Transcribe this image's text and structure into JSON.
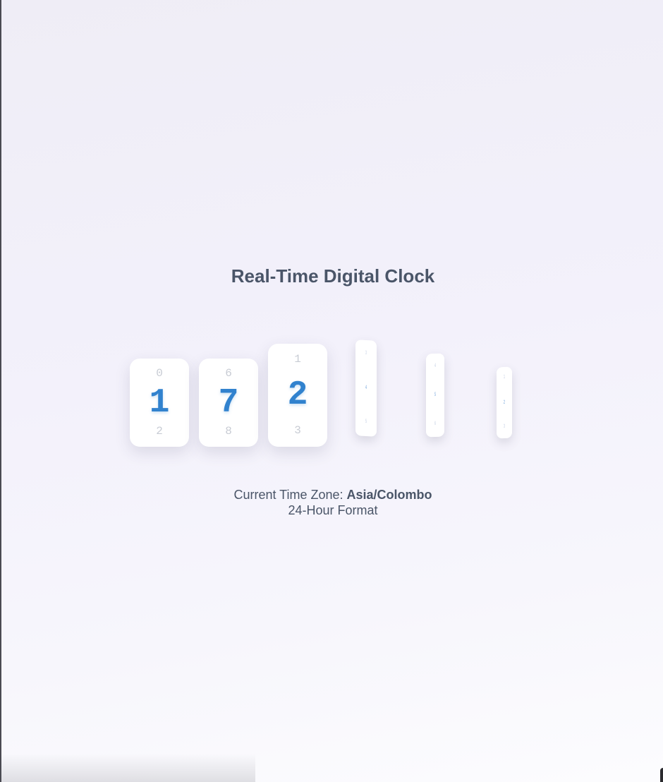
{
  "title": "Real-Time Digital Clock",
  "clock": {
    "digits": [
      {
        "prev": "0",
        "current": "1",
        "next": "2"
      },
      {
        "prev": "6",
        "current": "7",
        "next": "8"
      },
      {
        "prev": "1",
        "current": "2",
        "next": "3"
      },
      {
        "prev": "3",
        "current": "4",
        "next": "5"
      },
      {
        "prev": "4",
        "current": "5",
        "next": "6"
      },
      {
        "prev": "1",
        "current": "2",
        "next": "3"
      }
    ]
  },
  "info": {
    "timezone_label": "Current Time Zone: ",
    "timezone_value": "Asia/Colombo",
    "format_label": "24-Hour Format"
  },
  "colors": {
    "accent": "#3182ce",
    "text": "#4a5568",
    "muted": "#c8ccd4"
  }
}
